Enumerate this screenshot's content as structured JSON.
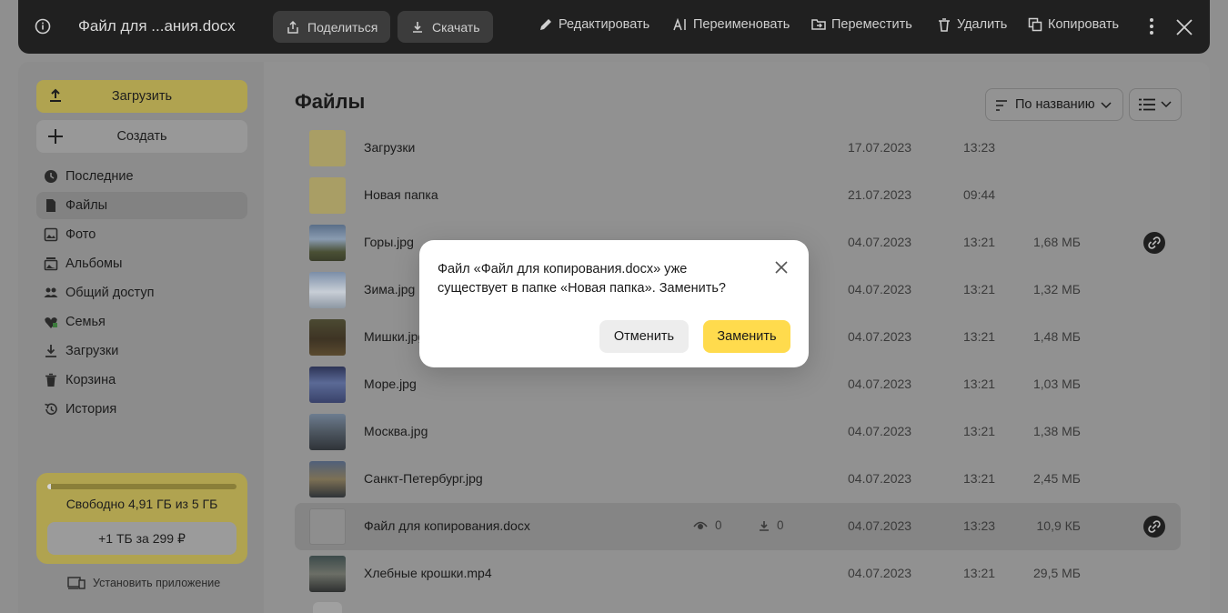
{
  "topbar": {
    "file_title": "Файл для ...ания.docx",
    "share_label": "Поделиться",
    "download_label": "Скачать",
    "edit_label": "Редактировать",
    "rename_label": "Переименовать",
    "move_label": "Переместить",
    "delete_label": "Удалить",
    "copy_label": "Копировать"
  },
  "sidebar": {
    "upload_label": "Загрузить",
    "create_label": "Создать",
    "items": [
      {
        "label": "Последние",
        "icon": "clock-icon"
      },
      {
        "label": "Файлы",
        "icon": "file-icon",
        "active": true
      },
      {
        "label": "Фото",
        "icon": "photo-icon"
      },
      {
        "label": "Альбомы",
        "icon": "album-icon"
      },
      {
        "label": "Общий доступ",
        "icon": "people-icon"
      },
      {
        "label": "Семья",
        "icon": "family-icon"
      },
      {
        "label": "Загрузки",
        "icon": "download-icon"
      },
      {
        "label": "Корзина",
        "icon": "trash-icon"
      },
      {
        "label": "История",
        "icon": "history-icon"
      }
    ],
    "storage": {
      "used_fraction": 0.018,
      "free_text": "Свободно 4,91 ГБ из 5 ГБ",
      "offer_label": "+1 ТБ за 299 ₽"
    },
    "install_app_label": "Установить приложение"
  },
  "main": {
    "title": "Файлы",
    "sort_label": "По названию",
    "files": [
      {
        "name": "Загрузки",
        "date": "17.07.2023",
        "time": "13:23",
        "size": "",
        "kind": "folder"
      },
      {
        "name": "Новая папка",
        "date": "21.07.2023",
        "time": "09:44",
        "size": "",
        "kind": "folder"
      },
      {
        "name": "Горы.jpg",
        "date": "04.07.2023",
        "time": "13:21",
        "size": "1,68 МБ",
        "kind": "image",
        "shared": true
      },
      {
        "name": "Зима.jpg",
        "date": "04.07.2023",
        "time": "13:21",
        "size": "1,32 МБ",
        "kind": "image"
      },
      {
        "name": "Мишки.jpg",
        "date": "04.07.2023",
        "time": "13:21",
        "size": "1,48 МБ",
        "kind": "image"
      },
      {
        "name": "Море.jpg",
        "date": "04.07.2023",
        "time": "13:21",
        "size": "1,03 МБ",
        "kind": "image"
      },
      {
        "name": "Москва.jpg",
        "date": "04.07.2023",
        "time": "13:21",
        "size": "1,38 МБ",
        "kind": "image"
      },
      {
        "name": "Санкт-Петербург.jpg",
        "date": "04.07.2023",
        "time": "13:21",
        "size": "2,45 МБ",
        "kind": "image"
      },
      {
        "name": "Файл для копирования.docx",
        "date": "04.07.2023",
        "time": "13:23",
        "size": "10,9 КБ",
        "kind": "doc",
        "shared": true,
        "selected": true,
        "views": "0",
        "downloads": "0"
      },
      {
        "name": "Хлебные крошки.mp4",
        "date": "04.07.2023",
        "time": "13:21",
        "size": "29,5 МБ",
        "kind": "video"
      }
    ]
  },
  "dialog": {
    "message": "Файл «Файл для копирования.docx» уже существует в папке «Новая папка». Заменить?",
    "cancel_label": "Отменить",
    "replace_label": "Заменить"
  },
  "colors": {
    "accent_yellow": "#ffdb4d",
    "toolbar_bg": "#202020",
    "overlay": "#8f8f8f"
  }
}
